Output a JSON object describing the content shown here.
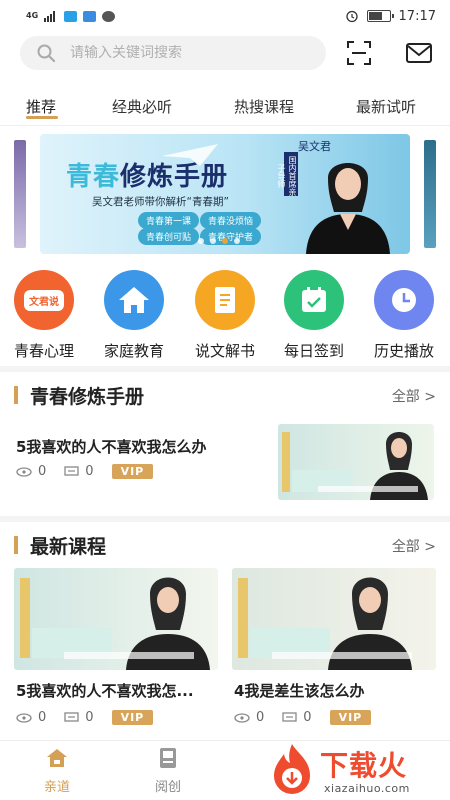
{
  "status_bar": {
    "network": "4G",
    "time": "17:17",
    "battery_level": 0.7
  },
  "search": {
    "placeholder": "请输入关键词搜索"
  },
  "tabs": [
    {
      "label": "推荐",
      "active": true
    },
    {
      "label": "经典必听",
      "active": false
    },
    {
      "label": "热搜课程",
      "active": false
    },
    {
      "label": "最新试听",
      "active": false
    }
  ],
  "banner": {
    "title_a": "青春",
    "title_b": "修炼手册",
    "subtitle": "吴文君老师带你解析“青春期”",
    "pills": [
      "青春第一课",
      "青春没烦恼",
      "青春创可贴",
      "青春守护者"
    ],
    "teacher_name": "吴文君",
    "teacher_tag": "国内首席亲子导师",
    "slide_index": 3,
    "slide_count": 4
  },
  "quick_actions": [
    {
      "label": "青春心理",
      "icon": "wenjunshuo-icon",
      "badge": "文君说",
      "color": "#f1632f"
    },
    {
      "label": "家庭教育",
      "icon": "home-icon",
      "color": "#3c97e8"
    },
    {
      "label": "说文解书",
      "icon": "book-icon",
      "color": "#f5a623"
    },
    {
      "label": "每日签到",
      "icon": "calendar-check-icon",
      "color": "#2dc279"
    },
    {
      "label": "历史播放",
      "icon": "clock-icon",
      "color": "#6f86f0"
    }
  ],
  "section1": {
    "title": "青春修炼手册",
    "more": "全部 >",
    "item": {
      "title": "5我喜欢的人不喜欢我怎么办",
      "views": "0",
      "comments": "0",
      "vip": "VIP"
    }
  },
  "section2": {
    "title": "最新课程",
    "more": "全部 >",
    "items": [
      {
        "title": "5我喜欢的人不喜欢我怎...",
        "views": "0",
        "comments": "0",
        "vip": "VIP"
      },
      {
        "title": "4我是差生该怎么办",
        "views": "0",
        "comments": "0",
        "vip": "VIP"
      }
    ]
  },
  "bottom_nav": [
    {
      "label": "亲道",
      "active": true
    },
    {
      "label": "阅创",
      "active": false
    }
  ],
  "watermark": {
    "text": "下载火",
    "url": "xiazaihuo.com"
  },
  "colors": {
    "accent": "#d4a055",
    "vip": "#d8a45a"
  }
}
